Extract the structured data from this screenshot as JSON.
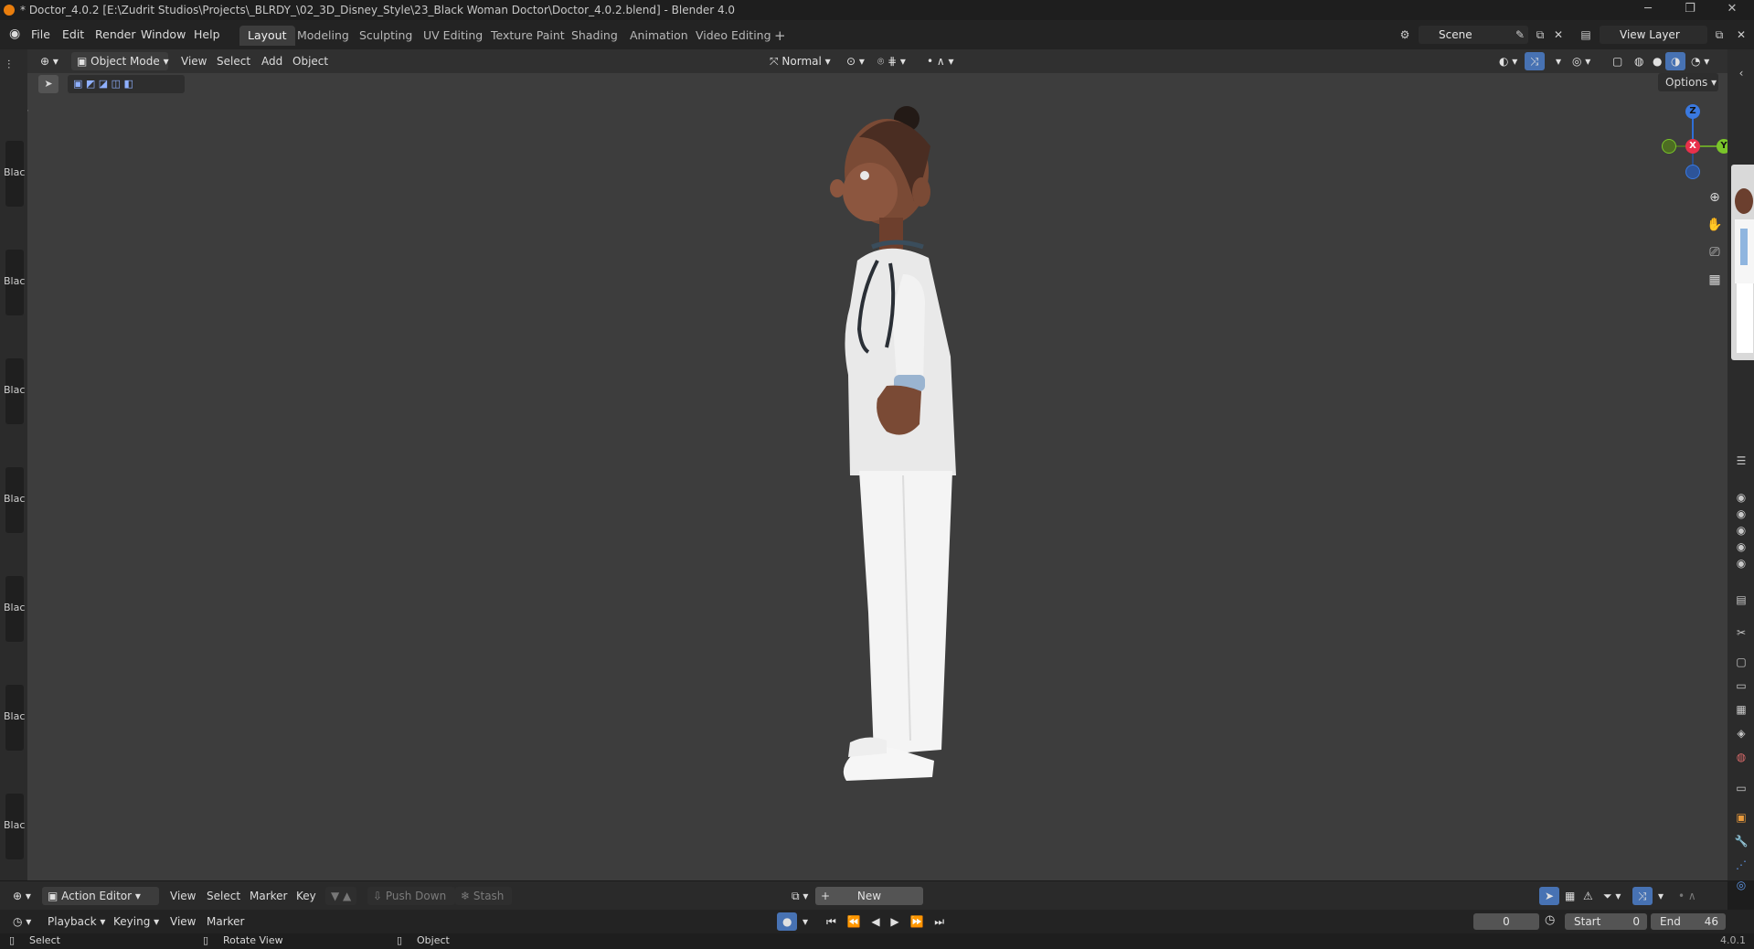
{
  "window": {
    "title": "* Doctor_4.0.2 [E:\\Zudrit Studios\\Projects\\_BLRDY_\\02_3D_Disney_Style\\23_Black Woman Doctor\\Doctor_4.0.2.blend] - Blender 4.0"
  },
  "menu": [
    "File",
    "Edit",
    "Render",
    "Window",
    "Help"
  ],
  "workspaces": [
    "Layout",
    "Modeling",
    "Sculpting",
    "UV Editing",
    "Texture Paint",
    "Shading",
    "Animation",
    "Video Editing"
  ],
  "scene": {
    "value": "Scene"
  },
  "view_layer": {
    "value": "View Layer"
  },
  "viewport_header": {
    "mode": "Object Mode",
    "menus": [
      "View",
      "Select",
      "Add",
      "Object"
    ],
    "orientation": "Normal",
    "options": "Options"
  },
  "gizmo": {
    "z": "Z",
    "x": "X",
    "y": "Y"
  },
  "action_thumbs": [
    "Blac",
    "Blac",
    "Blac",
    "Blac",
    "Blac",
    "Blac",
    "Blac"
  ],
  "action_editor": {
    "mode": "Action Editor",
    "menus": [
      "View",
      "Select",
      "Marker",
      "Key"
    ],
    "push_down": "Push Down",
    "stash": "Stash",
    "new_label": "New"
  },
  "timeline": {
    "playback": "Playback",
    "keying": "Keying",
    "view": "View",
    "marker": "Marker",
    "current_frame": "0",
    "start_label": "Start",
    "start_value": "0",
    "end_label": "End",
    "end_value": "46"
  },
  "status": {
    "select": "Select",
    "rotate": "Rotate View",
    "object": "Object",
    "version": "4.0.1"
  }
}
